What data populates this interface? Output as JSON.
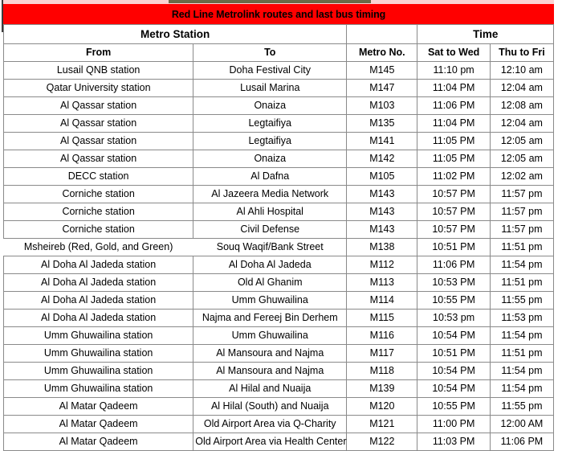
{
  "title": "Red Line Metrolink routes and last bus timing",
  "header": {
    "group_station": "Metro Station",
    "group_metro_no": "",
    "group_time": "Time",
    "col_from": "From",
    "col_to": "To",
    "col_metro_no": "Metro No.",
    "col_sat_to_wed": "Sat to Wed",
    "col_thu_to_fri": "Thu to Fri"
  },
  "colors": {
    "title_background": "#ff0000",
    "title_text": "#000000",
    "grid_line": "#8a8a8a",
    "top_strip": "#6b6a47",
    "top_sliver": "#fbd3d3"
  },
  "rows": [
    {
      "from": "Lusail QNB station",
      "to": "Doha Festival City",
      "metro_no": "M145",
      "sat_to_wed": "11:10 pm",
      "thu_to_fri": "12:10 am"
    },
    {
      "from": "Qatar University station",
      "to": "Lusail Marina",
      "metro_no": "M147",
      "sat_to_wed": "11:04 PM",
      "thu_to_fri": "12:04 am"
    },
    {
      "from": "Al Qassar station",
      "to": "Onaiza",
      "metro_no": "M103",
      "sat_to_wed": "11:06 PM",
      "thu_to_fri": "12:08 am"
    },
    {
      "from": "Al Qassar station",
      "to": "Legtaifiya",
      "metro_no": "M135",
      "sat_to_wed": "11:04 PM",
      "thu_to_fri": "12:04 am"
    },
    {
      "from": "Al Qassar station",
      "to": "Legtaifiya",
      "metro_no": "M141",
      "sat_to_wed": "11:05 PM",
      "thu_to_fri": "12:05 am"
    },
    {
      "from": "Al Qassar station",
      "to": "Onaiza",
      "metro_no": "M142",
      "sat_to_wed": "11:05 PM",
      "thu_to_fri": "12:05 am"
    },
    {
      "from": "DECC station",
      "to": "Al Dafna",
      "metro_no": "M105",
      "sat_to_wed": "11:02 PM",
      "thu_to_fri": "12:02 am"
    },
    {
      "from": "Corniche station",
      "to": "Al Jazeera Media Network",
      "metro_no": "M143",
      "sat_to_wed": "10:57 PM",
      "thu_to_fri": "11:57 pm"
    },
    {
      "from": "Corniche station",
      "to": "Al Ahli Hospital",
      "metro_no": "M143",
      "sat_to_wed": "10:57 PM",
      "thu_to_fri": "11:57 pm"
    },
    {
      "from": "Corniche station",
      "to": "Civil Defense",
      "metro_no": "M143",
      "sat_to_wed": "10:57 PM",
      "thu_to_fri": "11:57 pm"
    },
    {
      "from": "Msheireb (Red, Gold, and Green)",
      "to": "Souq Waqif/Bank Street",
      "metro_no": "M138",
      "sat_to_wed": "10:51 PM",
      "thu_to_fri": "11:51 pm",
      "overflow": true
    },
    {
      "from": "Al Doha Al Jadeda station",
      "to": "Al Doha Al Jadeda",
      "metro_no": "M112",
      "sat_to_wed": "11:06 PM",
      "thu_to_fri": "11:54 pm"
    },
    {
      "from": "Al Doha Al Jadeda station",
      "to": "Old Al Ghanim",
      "metro_no": "M113",
      "sat_to_wed": "10:53 PM",
      "thu_to_fri": "11:51 pm"
    },
    {
      "from": "Al Doha Al Jadeda station",
      "to": "Umm Ghuwailina",
      "metro_no": "M114",
      "sat_to_wed": "10:55 PM",
      "thu_to_fri": "11:55 pm"
    },
    {
      "from": "Al Doha Al Jadeda station",
      "to": "Najma and Fereej Bin Derhem",
      "metro_no": "M115",
      "sat_to_wed": "10:53 pm",
      "thu_to_fri": "11:53 pm"
    },
    {
      "from": "Umm Ghuwailina station",
      "to": "Umm Ghuwailina",
      "metro_no": "M116",
      "sat_to_wed": "10:54 PM",
      "thu_to_fri": "11:54 pm"
    },
    {
      "from": "Umm Ghuwailina station",
      "to": "Al Mansoura and Najma",
      "metro_no": "M117",
      "sat_to_wed": "10:51 PM",
      "thu_to_fri": "11:51 pm"
    },
    {
      "from": "Umm Ghuwailina station",
      "to": "Al Mansoura and Najma",
      "metro_no": "M118",
      "sat_to_wed": "10:54 PM",
      "thu_to_fri": "11:54 pm"
    },
    {
      "from": "Umm Ghuwailina station",
      "to": "Al Hilal and Nuaija",
      "metro_no": "M139",
      "sat_to_wed": "10:54 PM",
      "thu_to_fri": "11:54 pm"
    },
    {
      "from": "Al Matar Qadeem",
      "to": "Al Hilal (South) and Nuaija",
      "metro_no": "M120",
      "sat_to_wed": "10:55 PM",
      "thu_to_fri": "11:55 pm"
    },
    {
      "from": "Al Matar Qadeem",
      "to": "Old Airport Area via Q-Charity",
      "metro_no": "M121",
      "sat_to_wed": "11:00 PM",
      "thu_to_fri": "12:00 AM"
    },
    {
      "from": "Al Matar Qadeem",
      "to": "Old Airport Area via Health Center",
      "metro_no": "M122",
      "sat_to_wed": "11:03 PM",
      "thu_to_fri": "11:06 PM"
    }
  ]
}
